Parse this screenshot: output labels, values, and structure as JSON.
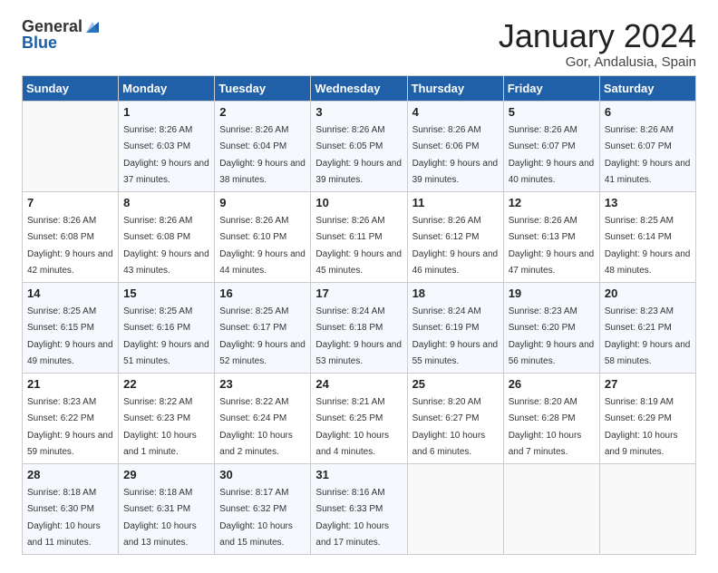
{
  "header": {
    "logo_general": "General",
    "logo_blue": "Blue",
    "title": "January 2024",
    "location": "Gor, Andalusia, Spain"
  },
  "weekdays": [
    "Sunday",
    "Monday",
    "Tuesday",
    "Wednesday",
    "Thursday",
    "Friday",
    "Saturday"
  ],
  "weeks": [
    [
      {
        "day": "",
        "sunrise": "",
        "sunset": "",
        "daylight": ""
      },
      {
        "day": "1",
        "sunrise": "Sunrise: 8:26 AM",
        "sunset": "Sunset: 6:03 PM",
        "daylight": "Daylight: 9 hours and 37 minutes."
      },
      {
        "day": "2",
        "sunrise": "Sunrise: 8:26 AM",
        "sunset": "Sunset: 6:04 PM",
        "daylight": "Daylight: 9 hours and 38 minutes."
      },
      {
        "day": "3",
        "sunrise": "Sunrise: 8:26 AM",
        "sunset": "Sunset: 6:05 PM",
        "daylight": "Daylight: 9 hours and 39 minutes."
      },
      {
        "day": "4",
        "sunrise": "Sunrise: 8:26 AM",
        "sunset": "Sunset: 6:06 PM",
        "daylight": "Daylight: 9 hours and 39 minutes."
      },
      {
        "day": "5",
        "sunrise": "Sunrise: 8:26 AM",
        "sunset": "Sunset: 6:07 PM",
        "daylight": "Daylight: 9 hours and 40 minutes."
      },
      {
        "day": "6",
        "sunrise": "Sunrise: 8:26 AM",
        "sunset": "Sunset: 6:07 PM",
        "daylight": "Daylight: 9 hours and 41 minutes."
      }
    ],
    [
      {
        "day": "7",
        "sunrise": "Sunrise: 8:26 AM",
        "sunset": "Sunset: 6:08 PM",
        "daylight": "Daylight: 9 hours and 42 minutes."
      },
      {
        "day": "8",
        "sunrise": "Sunrise: 8:26 AM",
        "sunset": "Sunset: 6:08 PM",
        "daylight": "Daylight: 9 hours and 43 minutes."
      },
      {
        "day": "9",
        "sunrise": "Sunrise: 8:26 AM",
        "sunset": "Sunset: 6:10 PM",
        "daylight": "Daylight: 9 hours and 44 minutes."
      },
      {
        "day": "10",
        "sunrise": "Sunrise: 8:26 AM",
        "sunset": "Sunset: 6:11 PM",
        "daylight": "Daylight: 9 hours and 45 minutes."
      },
      {
        "day": "11",
        "sunrise": "Sunrise: 8:26 AM",
        "sunset": "Sunset: 6:12 PM",
        "daylight": "Daylight: 9 hours and 46 minutes."
      },
      {
        "day": "12",
        "sunrise": "Sunrise: 8:26 AM",
        "sunset": "Sunset: 6:13 PM",
        "daylight": "Daylight: 9 hours and 47 minutes."
      },
      {
        "day": "13",
        "sunrise": "Sunrise: 8:25 AM",
        "sunset": "Sunset: 6:14 PM",
        "daylight": "Daylight: 9 hours and 48 minutes."
      }
    ],
    [
      {
        "day": "14",
        "sunrise": "Sunrise: 8:25 AM",
        "sunset": "Sunset: 6:15 PM",
        "daylight": "Daylight: 9 hours and 49 minutes."
      },
      {
        "day": "15",
        "sunrise": "Sunrise: 8:25 AM",
        "sunset": "Sunset: 6:16 PM",
        "daylight": "Daylight: 9 hours and 51 minutes."
      },
      {
        "day": "16",
        "sunrise": "Sunrise: 8:25 AM",
        "sunset": "Sunset: 6:17 PM",
        "daylight": "Daylight: 9 hours and 52 minutes."
      },
      {
        "day": "17",
        "sunrise": "Sunrise: 8:24 AM",
        "sunset": "Sunset: 6:18 PM",
        "daylight": "Daylight: 9 hours and 53 minutes."
      },
      {
        "day": "18",
        "sunrise": "Sunrise: 8:24 AM",
        "sunset": "Sunset: 6:19 PM",
        "daylight": "Daylight: 9 hours and 55 minutes."
      },
      {
        "day": "19",
        "sunrise": "Sunrise: 8:23 AM",
        "sunset": "Sunset: 6:20 PM",
        "daylight": "Daylight: 9 hours and 56 minutes."
      },
      {
        "day": "20",
        "sunrise": "Sunrise: 8:23 AM",
        "sunset": "Sunset: 6:21 PM",
        "daylight": "Daylight: 9 hours and 58 minutes."
      }
    ],
    [
      {
        "day": "21",
        "sunrise": "Sunrise: 8:23 AM",
        "sunset": "Sunset: 6:22 PM",
        "daylight": "Daylight: 9 hours and 59 minutes."
      },
      {
        "day": "22",
        "sunrise": "Sunrise: 8:22 AM",
        "sunset": "Sunset: 6:23 PM",
        "daylight": "Daylight: 10 hours and 1 minute."
      },
      {
        "day": "23",
        "sunrise": "Sunrise: 8:22 AM",
        "sunset": "Sunset: 6:24 PM",
        "daylight": "Daylight: 10 hours and 2 minutes."
      },
      {
        "day": "24",
        "sunrise": "Sunrise: 8:21 AM",
        "sunset": "Sunset: 6:25 PM",
        "daylight": "Daylight: 10 hours and 4 minutes."
      },
      {
        "day": "25",
        "sunrise": "Sunrise: 8:20 AM",
        "sunset": "Sunset: 6:27 PM",
        "daylight": "Daylight: 10 hours and 6 minutes."
      },
      {
        "day": "26",
        "sunrise": "Sunrise: 8:20 AM",
        "sunset": "Sunset: 6:28 PM",
        "daylight": "Daylight: 10 hours and 7 minutes."
      },
      {
        "day": "27",
        "sunrise": "Sunrise: 8:19 AM",
        "sunset": "Sunset: 6:29 PM",
        "daylight": "Daylight: 10 hours and 9 minutes."
      }
    ],
    [
      {
        "day": "28",
        "sunrise": "Sunrise: 8:18 AM",
        "sunset": "Sunset: 6:30 PM",
        "daylight": "Daylight: 10 hours and 11 minutes."
      },
      {
        "day": "29",
        "sunrise": "Sunrise: 8:18 AM",
        "sunset": "Sunset: 6:31 PM",
        "daylight": "Daylight: 10 hours and 13 minutes."
      },
      {
        "day": "30",
        "sunrise": "Sunrise: 8:17 AM",
        "sunset": "Sunset: 6:32 PM",
        "daylight": "Daylight: 10 hours and 15 minutes."
      },
      {
        "day": "31",
        "sunrise": "Sunrise: 8:16 AM",
        "sunset": "Sunset: 6:33 PM",
        "daylight": "Daylight: 10 hours and 17 minutes."
      },
      {
        "day": "",
        "sunrise": "",
        "sunset": "",
        "daylight": ""
      },
      {
        "day": "",
        "sunrise": "",
        "sunset": "",
        "daylight": ""
      },
      {
        "day": "",
        "sunrise": "",
        "sunset": "",
        "daylight": ""
      }
    ]
  ]
}
